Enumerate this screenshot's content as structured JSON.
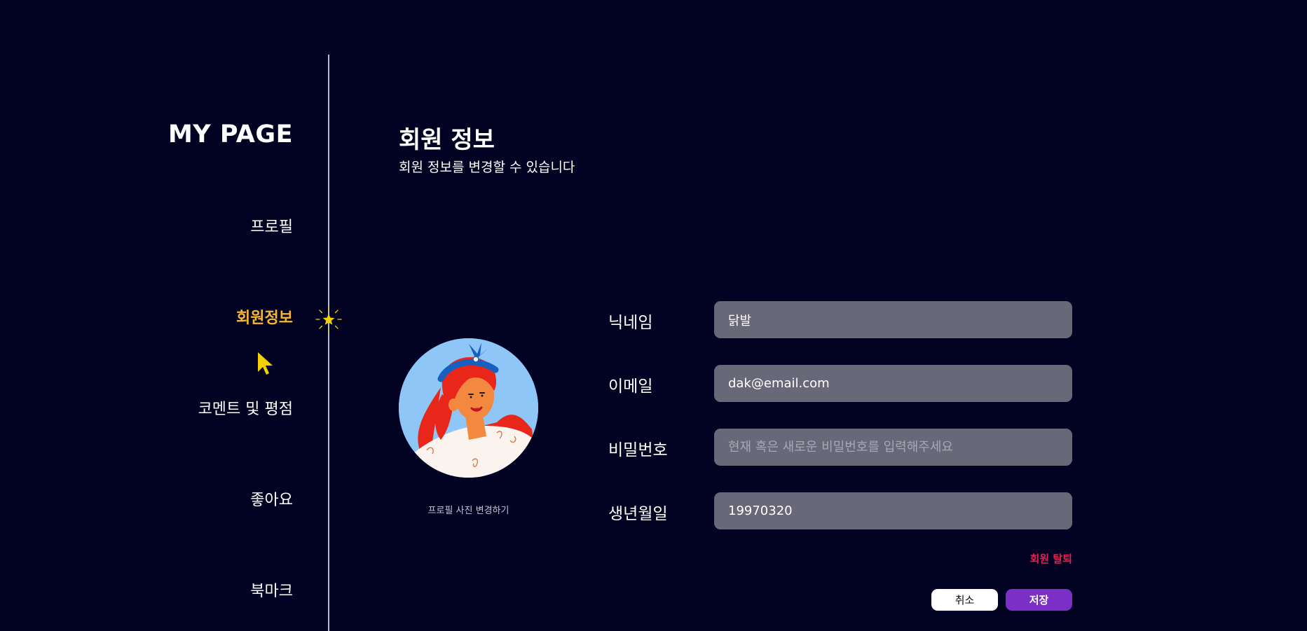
{
  "sidebar": {
    "title": "MY PAGE",
    "items": [
      {
        "label": "프로필",
        "active": false
      },
      {
        "label": "회원정보",
        "active": true
      },
      {
        "label": "코멘트 및 평점",
        "active": false
      },
      {
        "label": "좋아요",
        "active": false
      },
      {
        "label": "북마크",
        "active": false
      }
    ],
    "active_color": "#f5b731"
  },
  "header": {
    "title": "회원 정보",
    "subtitle": "회원 정보를 변경할 수 있습니다"
  },
  "profile": {
    "change_photo_label": "프로필 사진 변경하기"
  },
  "form": {
    "fields": [
      {
        "label": "닉네임",
        "value": "닭발",
        "placeholder": ""
      },
      {
        "label": "이메일",
        "value": "dak@email.com",
        "placeholder": ""
      },
      {
        "label": "비밀번호",
        "value": "",
        "placeholder": "현재 혹은 새로운 비밀번호를 입력해주세요"
      },
      {
        "label": "생년월일",
        "value": "19970320",
        "placeholder": ""
      }
    ],
    "withdraw_label": "회원 탈퇴",
    "cancel_label": "취소",
    "save_label": "저장"
  },
  "colors": {
    "background": "#020222",
    "input_bg": "#686879",
    "save_button": "#7b2fc7",
    "withdraw_text": "#e2214f"
  }
}
